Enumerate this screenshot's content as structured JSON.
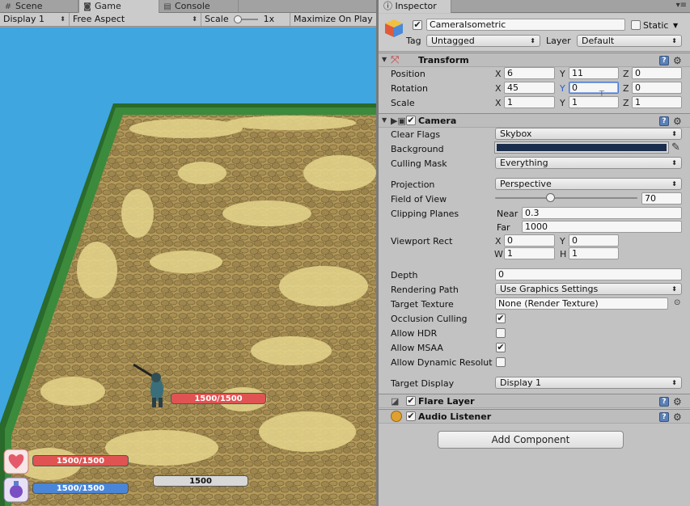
{
  "left_tabs": [
    {
      "label": "Scene",
      "icon": "grid-icon"
    },
    {
      "label": "Game",
      "icon": "gamepad-icon"
    },
    {
      "label": "Console",
      "icon": "console-icon"
    }
  ],
  "game_toolbar": {
    "display": "Display 1",
    "aspect": "Free Aspect",
    "scale_label": "Scale",
    "scale_value": "1x",
    "maximize": "Maximize On Play"
  },
  "hud": {
    "enemy_hp": "1500/1500",
    "player_hp": "1500/1500",
    "player_mp": "1500/1500",
    "exp": "1500",
    "health_icon": "heart-icon",
    "mana_icon": "potion-icon"
  },
  "inspector": {
    "tab": "Inspector",
    "object_name": "CameraIsometric",
    "static_label": "Static",
    "tag_label": "Tag",
    "tag_value": "Untagged",
    "layer_label": "Layer",
    "layer_value": "Default",
    "transform": {
      "title": "Transform",
      "position_label": "Position",
      "rotation_label": "Rotation",
      "scale_label": "Scale",
      "position": {
        "x": "6",
        "y": "11",
        "z": "0"
      },
      "rotation": {
        "x": "45",
        "y": "0",
        "z": "0"
      },
      "scale": {
        "x": "1",
        "y": "1",
        "z": "1"
      }
    },
    "camera": {
      "title": "Camera",
      "clear_flags_label": "Clear Flags",
      "clear_flags": "Skybox",
      "background_label": "Background",
      "background_color": "#1b2d4d",
      "culling_mask_label": "Culling Mask",
      "culling_mask": "Everything",
      "projection_label": "Projection",
      "projection": "Perspective",
      "fov_label": "Field of View",
      "fov": "70",
      "fov_fraction": 0.38,
      "clipping_label": "Clipping Planes",
      "near_label": "Near",
      "near": "0.3",
      "far_label": "Far",
      "far": "1000",
      "viewport_label": "Viewport Rect",
      "viewport": {
        "x": "0",
        "y": "0",
        "w": "1",
        "h": "1"
      },
      "depth_label": "Depth",
      "depth": "0",
      "rendering_path_label": "Rendering Path",
      "rendering_path": "Use Graphics Settings",
      "target_texture_label": "Target Texture",
      "target_texture": "None (Render Texture)",
      "occlusion_label": "Occlusion Culling",
      "hdr_label": "Allow HDR",
      "msaa_label": "Allow MSAA",
      "dynres_label": "Allow Dynamic Resolut",
      "target_display_label": "Target Display",
      "target_display": "Display 1"
    },
    "flare_layer": "Flare Layer",
    "audio_listener": "Audio Listener",
    "add_component": "Add Component"
  }
}
